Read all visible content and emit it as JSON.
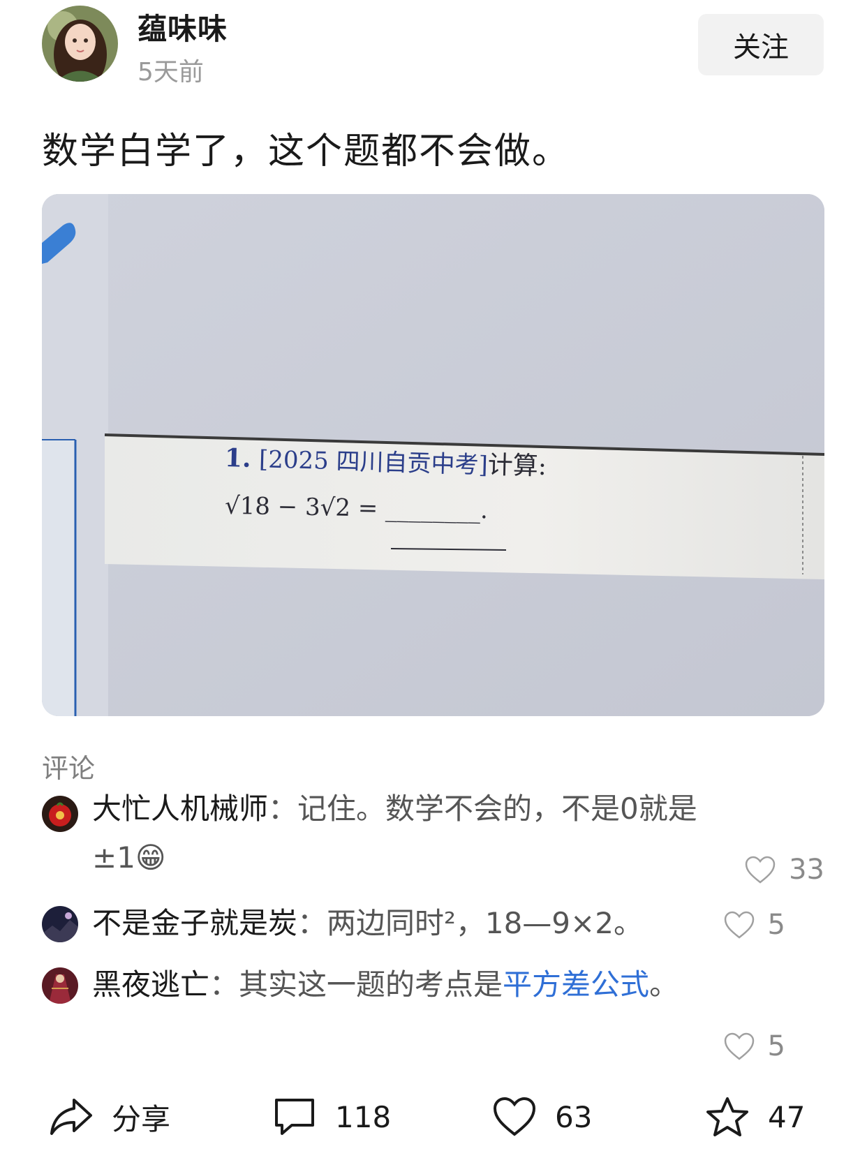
{
  "header": {
    "author": "蕴味味",
    "time": "5天前",
    "follow_label": "关注"
  },
  "post": {
    "text": "数学白学了，这个题都不会做。",
    "photo": {
      "line1_num": "1.",
      "line1_tag": "[2025 四川自贡中考]",
      "line1_suffix": "计算:",
      "line2": "√18 − 3√2 = ________."
    }
  },
  "comments_label": "评论",
  "comments": [
    {
      "name": "大忙人机械师",
      "sep": "：",
      "text": "记住。数学不会的，不是0就是 ±1😁",
      "link": "",
      "tail": "",
      "likes": "33"
    },
    {
      "name": "不是金子就是炭",
      "sep": "：",
      "text": "两边同时²，18—9×2。",
      "link": "",
      "tail": "",
      "likes": "5"
    },
    {
      "name": "黑夜逃亡",
      "sep": "：",
      "text": "其实这一题的考点是",
      "link": "平方差公式",
      "tail": "。",
      "likes": "5"
    }
  ],
  "bottom_bar": {
    "share_label": "分享",
    "comment_count": "118",
    "like_count": "63",
    "favorite_count": "47"
  },
  "icons": {
    "like": "heart-icon",
    "share": "share-icon",
    "comment": "comment-icon",
    "favorite": "star-icon"
  },
  "colors": {
    "link": "#2f6fd6",
    "muted": "#9a9a9a",
    "follow_bg": "#f2f2f2"
  }
}
